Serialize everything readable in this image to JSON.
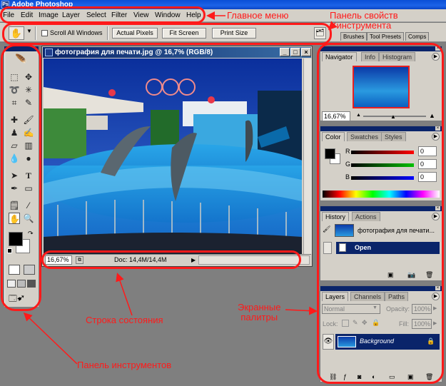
{
  "app": {
    "title": "Adobe Photoshop"
  },
  "menu": {
    "items": [
      "File",
      "Edit",
      "Image",
      "Layer",
      "Select",
      "Filter",
      "View",
      "Window",
      "Help"
    ]
  },
  "options_bar": {
    "tool_icon": "hand-icon",
    "scroll_all_windows": "Scroll All Windows",
    "actual_pixels": "Actual Pixels",
    "fit_screen": "Fit Screen",
    "print_size": "Print Size"
  },
  "palette_well": {
    "tabs": [
      "Brushes",
      "Tool Presets",
      "Comps"
    ]
  },
  "document": {
    "title": "фотография для печати.jpg @ 16,7% (RGB/8)",
    "zoom": "16,67%",
    "doc_size": "Doc: 14,4M/14,4M"
  },
  "navigator": {
    "tabs": [
      "Navigator",
      "Info",
      "Histogram"
    ],
    "zoom": "16,67%"
  },
  "color": {
    "tabs": [
      "Color",
      "Swatches",
      "Styles"
    ],
    "channels": [
      {
        "label": "R",
        "value": "0",
        "color": "#ff0000"
      },
      {
        "label": "G",
        "value": "0",
        "color": "#00b000"
      },
      {
        "label": "B",
        "value": "0",
        "color": "#0000ff"
      }
    ]
  },
  "history": {
    "tabs": [
      "History",
      "Actions"
    ],
    "snapshot": "фотография для печати...",
    "state": "Open"
  },
  "layers": {
    "tabs": [
      "Layers",
      "Channels",
      "Paths"
    ],
    "blend_mode": "Normal",
    "opacity_label": "Opacity:",
    "opacity": "100%",
    "lock_label": "Lock:",
    "fill_label": "Fill:",
    "fill": "100%",
    "layer_name": "Background"
  },
  "annotations": {
    "main_menu": "Главное меню",
    "options_panel": "Панель свойств\nинструмента",
    "status_bar": "Строка состояния",
    "screen_palettes": "Экранные\nпалитры",
    "toolbox": "Панель инструментов"
  },
  "colors": {
    "title_bar": "#0a4fd6",
    "selection": "#0a246a",
    "annotation": "#ff1a1a"
  }
}
